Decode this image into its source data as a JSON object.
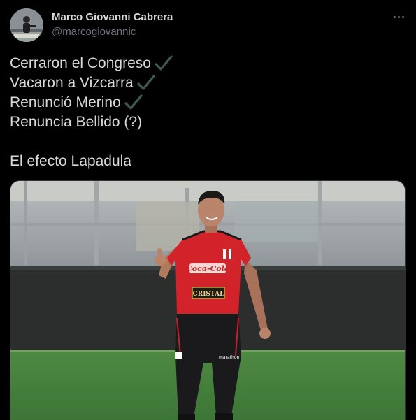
{
  "author": {
    "display_name": "Marco Giovanni Cabrera",
    "handle": "@marcogiovannic"
  },
  "tweet": {
    "lines": [
      "Cerraron el Congreso",
      "Vacaron a Vizcarra",
      "Renunció Merino",
      "Renuncia Bellido (?)",
      "",
      "El efecto Lapadula"
    ],
    "check_icons": [
      "check-mark-icon",
      "check-mark-icon",
      "check-mark-icon"
    ]
  },
  "media": {
    "jersey_sponsor": "Coca-Cola",
    "jersey_sponsor_secondary": "CRISTAL",
    "shorts_brand": "marathon"
  },
  "colors": {
    "background": "#000000",
    "text_primary": "#d9d9d9",
    "text_secondary": "#6e767d",
    "check_color": "#3f5a50",
    "jersey_red": "#d2232a"
  },
  "icons": {
    "more": "more-horizontal-icon",
    "check": "check-mark-icon"
  }
}
